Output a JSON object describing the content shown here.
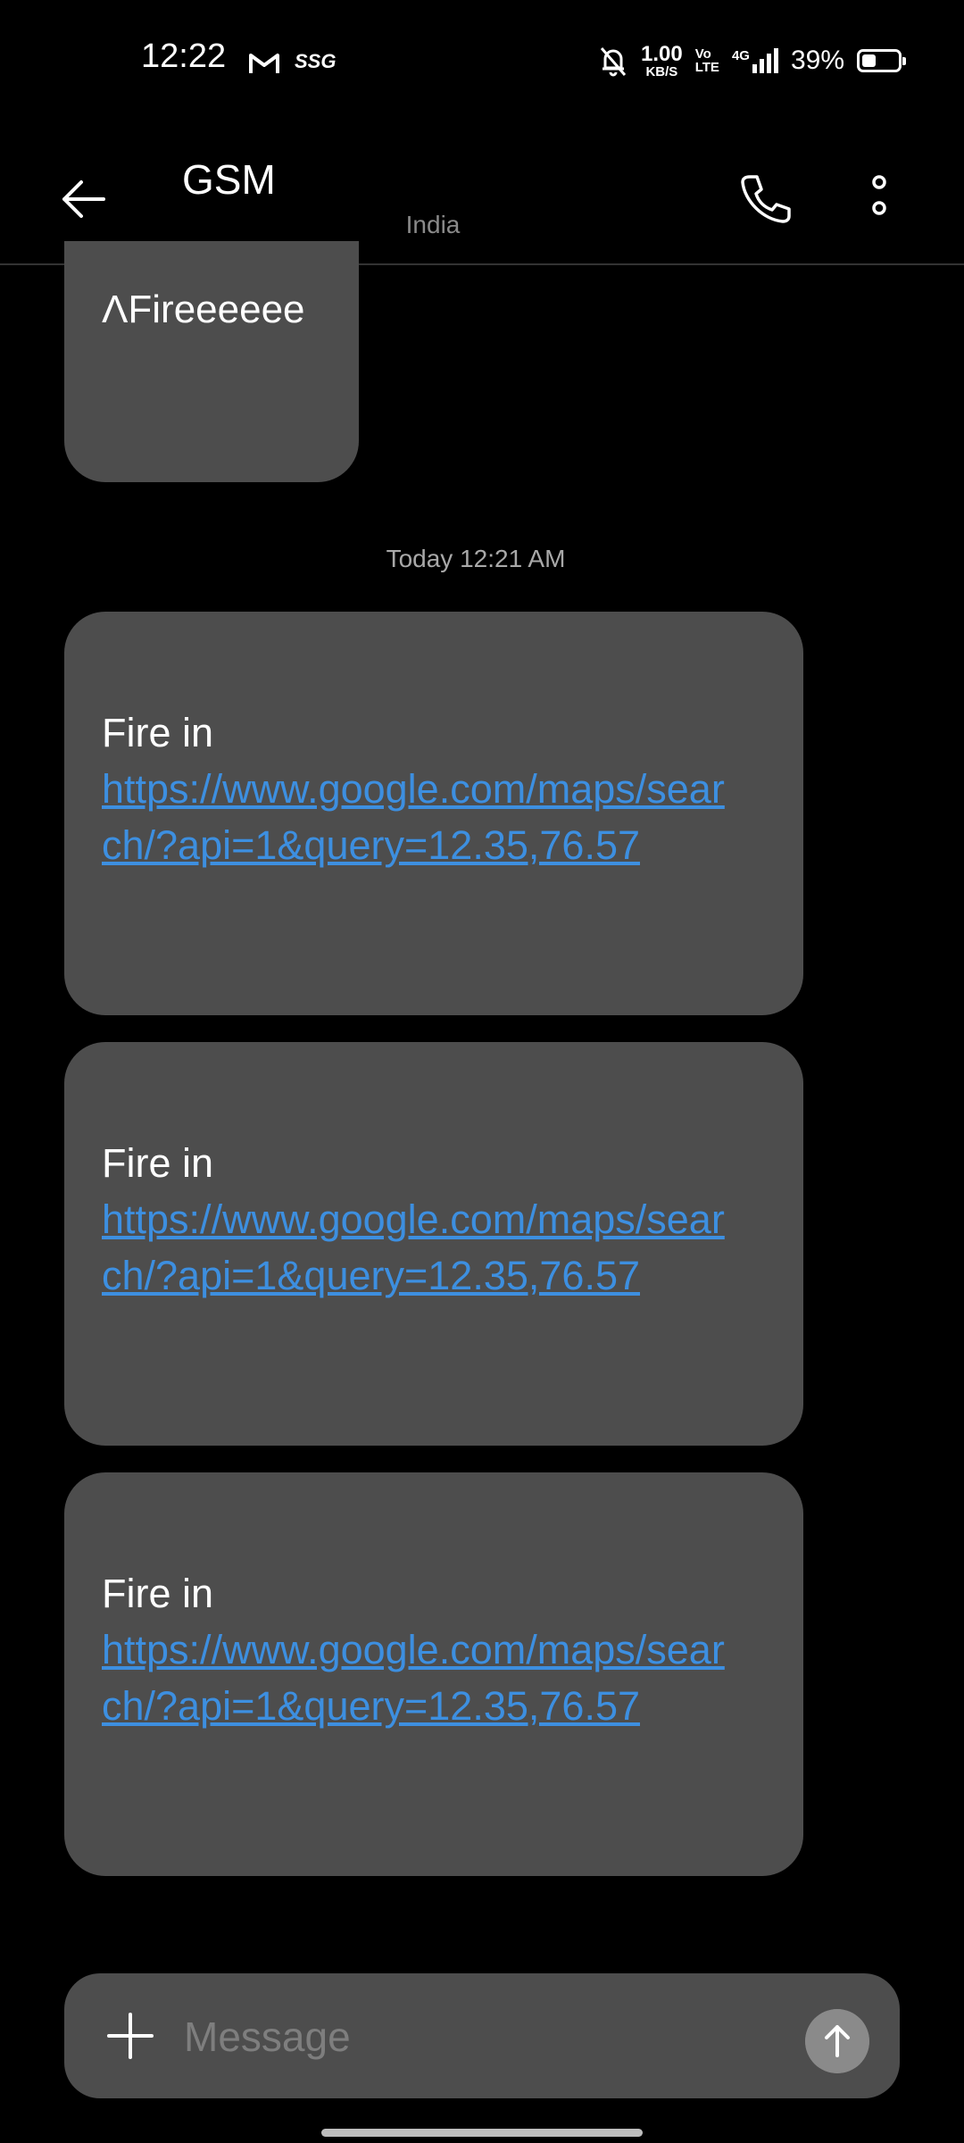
{
  "status_bar": {
    "time": "12:22",
    "sim_label": "SSG",
    "speed_value": "1.00",
    "speed_unit": "KB/S",
    "volte_top": "Vo",
    "volte_bottom": "LTE",
    "network": "4G",
    "battery_pct": "39%",
    "battery_level": 0.39,
    "icons": [
      "gmail-icon",
      "mute-bell-icon",
      "signal-icon",
      "battery-icon"
    ]
  },
  "app_bar": {
    "title": "GSM",
    "subtitle": "India",
    "icons": [
      "back-arrow-icon",
      "phone-icon",
      "more-vertical-icon"
    ]
  },
  "conversation": {
    "first_message": "ΛFireeeeee",
    "timestamp": "Today 12:21 AM",
    "messages": [
      {
        "text": "Fire in",
        "link": "https://www.google.com/maps/search/?api=1&query=12.35,76.57"
      },
      {
        "text": "Fire in",
        "link": "https://www.google.com/maps/search/?api=1&query=12.35,76.57"
      },
      {
        "text": "Fire in",
        "link": "https://www.google.com/maps/search/?api=1&query=12.35,76.57"
      }
    ]
  },
  "compose": {
    "placeholder": "Message",
    "icons": [
      "plus-icon",
      "send-arrow-icon"
    ]
  },
  "colors": {
    "background": "#000000",
    "bubble": "#4d4d4d",
    "link": "#3d8fe0",
    "muted_text": "#8a8a8a"
  }
}
